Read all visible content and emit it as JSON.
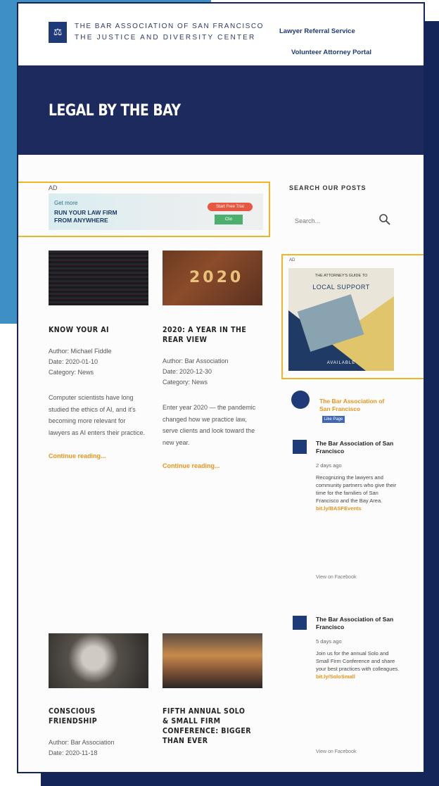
{
  "header": {
    "logo_line1": "THE BAR ASSOCIATION OF SAN FRANCISCO",
    "logo_line2": "THE JUSTICE AND DIVERSITY CENTER",
    "nav": [
      "Lawyer Referral Service",
      "Volunteer Attorney Portal"
    ]
  },
  "banner": {
    "title": "LEGAL BY THE BAY"
  },
  "main_ad": {
    "tag": "AD",
    "line1": "Get more",
    "line2": "RUN YOUR LAW FIRM",
    "line3": "FROM ANYWHERE",
    "button1": "Start Free Trial",
    "button2": "Clio"
  },
  "posts": [
    {
      "title": "KNOW YOUR AI",
      "meta": [
        "Author: Michael Fiddle",
        "Date: 2020-01-10",
        "Category: News"
      ],
      "excerpt": "Computer scientists have long studied the ethics of AI, and it's becoming more relevant for lawyers as AI enters their practice.",
      "more": "Continue reading..."
    },
    {
      "title": "2020: A YEAR IN THE REAR VIEW",
      "meta": [
        "Author: Bar Association",
        "Date: 2020-12-30",
        "Category: News"
      ],
      "excerpt": "Enter year 2020 — the pandemic changed how we practice law, serve clients and look toward the new year.",
      "more": "Continue reading..."
    },
    {
      "title": "CONSCIOUS FRIENDSHIP",
      "meta": [
        "Author: Bar Association",
        "Date: 2020-11-18"
      ],
      "excerpt": "",
      "more": ""
    },
    {
      "title": "FIFTH ANNUAL SOLO & SMALL FIRM CONFERENCE: BIGGER THAN EVER",
      "meta": [],
      "excerpt": "",
      "more": ""
    }
  ],
  "sidebar": {
    "heading": "SEARCH OUR POSTS",
    "search_placeholder": "Search...",
    "ad_tag": "AD",
    "book_kicker": "THE ATTORNEY'S GUIDE TO",
    "book_title": "LOCAL SUPPORT",
    "book_footer": "AVAILABLE",
    "fb_title": "The Bar Association of San Francisco",
    "fb_like": "Like Page",
    "fb_posts": [
      {
        "name": "The Bar Association of San Francisco",
        "date": "2 days ago",
        "text": "Recognizing the lawyers and community partners who give their time for the families of San Francisco and the Bay Area.",
        "link": "bit.ly/BASFEvents",
        "foot": "View on Facebook"
      },
      {
        "name": "The Bar Association of San Francisco",
        "date": "5 days ago",
        "text": "Join us for the annual Solo and Small Firm Conference and share your best practices with colleagues.",
        "link": "bit.ly/SoloSmall",
        "foot": "View on Facebook"
      }
    ]
  }
}
